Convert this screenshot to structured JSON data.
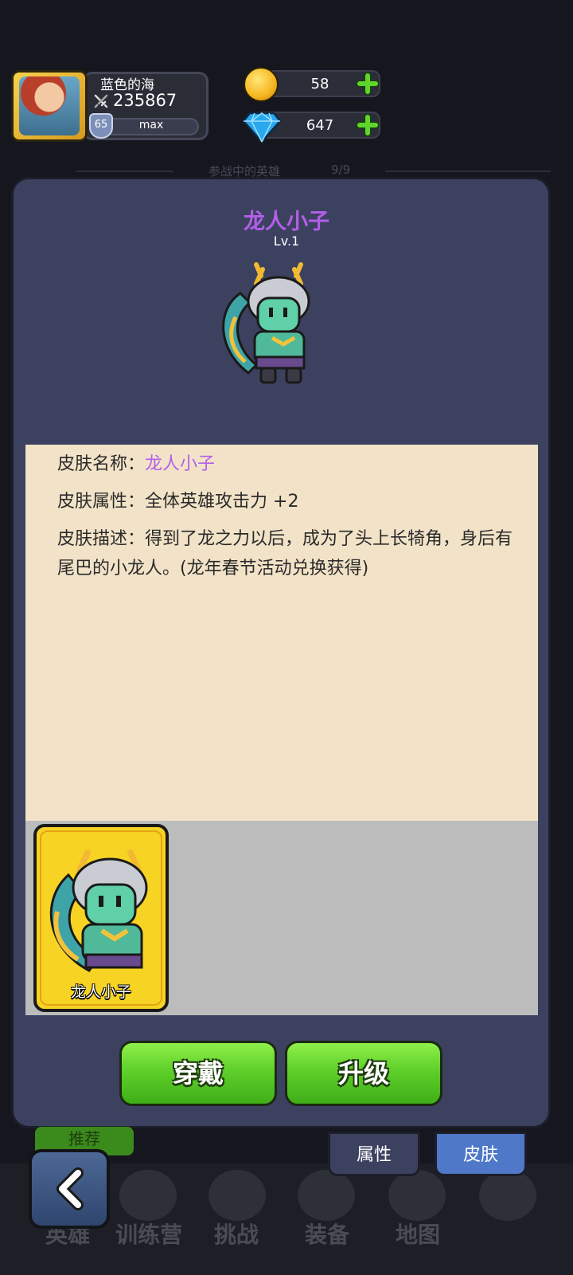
{
  "player": {
    "name": "蓝色的海",
    "power": "235867",
    "level": "65",
    "level_status": "max"
  },
  "resources": {
    "gold": "58",
    "diamonds": "647"
  },
  "background": {
    "heroes_label": "参战中的英雄",
    "heroes_count": "9/9",
    "recommend_label": "推荐"
  },
  "hero": {
    "name": "龙人小子",
    "level": "Lv.1"
  },
  "skin_info": {
    "name_key": "皮肤名称：",
    "name_value": "龙人小子",
    "attr_key": "皮肤属性：",
    "attr_value": "全体英雄攻击力 +2",
    "desc_key": "皮肤描述：",
    "desc_value": "得到了龙之力以后，成为了头上长犄角，身后有尾巴的小龙人。(龙年春节活动兑换获得)"
  },
  "skin_card": {
    "label": "龙人小子"
  },
  "actions": {
    "wear": "穿戴",
    "upgrade": "升级"
  },
  "tabs": {
    "attributes": "属性",
    "skins": "皮肤"
  },
  "bottom_nav": [
    "英雄",
    "训练营",
    "挑战",
    "装备",
    "地图"
  ],
  "colors": {
    "accent_purple": "#b25fe8",
    "button_green": "#5fcf2a",
    "dialog_bg": "#3c4160",
    "panel_bg": "#f2e3c8",
    "tab_active": "#4f78c9"
  }
}
